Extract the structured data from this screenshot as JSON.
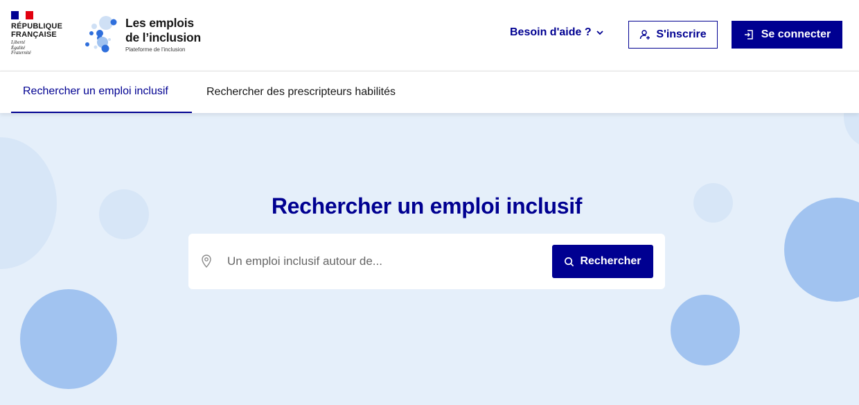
{
  "header": {
    "republic": {
      "line1": "RÉPUBLIQUE",
      "line2": "FRANÇAISE",
      "motto1": "Liberté",
      "motto2": "Égalité",
      "motto3": "Fraternité"
    },
    "brand": {
      "title_line1": "Les emplois",
      "title_line2": "de l’inclusion",
      "subtitle": "Plateforme de l'inclusion"
    },
    "help_label": "Besoin d'aide ?",
    "signup_label": "S'inscrire",
    "login_label": "Se connecter"
  },
  "tabs": [
    {
      "label": "Rechercher un emploi inclusif",
      "active": true
    },
    {
      "label": "Rechercher des prescripteurs habilités",
      "active": false
    }
  ],
  "hero": {
    "title": "Rechercher un emploi inclusif",
    "search_placeholder": "Un emploi inclusif autour de...",
    "search_button": "Rechercher"
  },
  "icons": {
    "help": "chevron-down-icon",
    "signup": "user-add-icon",
    "login": "login-icon",
    "location": "map-pin-icon",
    "search": "search-icon"
  },
  "colors": {
    "primary": "#000091",
    "hero_bg": "#e5effa",
    "bubble_light": "#cfe0f5",
    "bubble_mid": "#a1c3f0",
    "flag_blue": "#000091",
    "flag_red": "#e1000f"
  }
}
